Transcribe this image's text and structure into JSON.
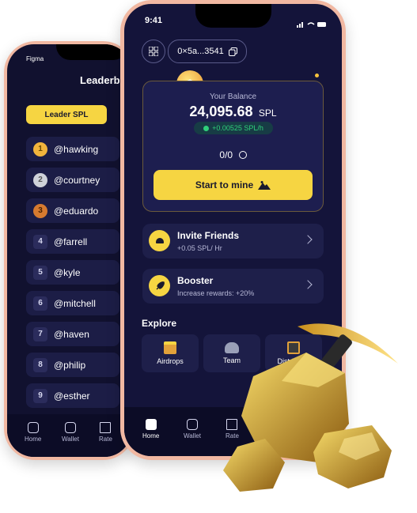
{
  "back_phone": {
    "status_app": "Figma",
    "title": "Leaderboard",
    "tab_button": "Leader SPL",
    "leaders": [
      {
        "rank": "1",
        "name": "@hawking",
        "badge_color": "#f2b43c"
      },
      {
        "rank": "2",
        "name": "@courtney",
        "badge_color": "#cfd2d9"
      },
      {
        "rank": "3",
        "name": "@eduardo",
        "badge_color": "#d67a2f"
      },
      {
        "rank": "4",
        "name": "@farrell"
      },
      {
        "rank": "5",
        "name": "@kyle"
      },
      {
        "rank": "6",
        "name": "@mitchell"
      },
      {
        "rank": "7",
        "name": "@haven"
      },
      {
        "rank": "8",
        "name": "@philip"
      },
      {
        "rank": "9",
        "name": "@esther"
      }
    ],
    "nav": [
      "Home",
      "Wallet",
      "Rate"
    ]
  },
  "front_phone": {
    "time": "9:41",
    "wallet_address": "0×5a...3541",
    "balance": {
      "label": "Your Balance",
      "amount": "24,095.68",
      "unit": "SPL",
      "rate": "+0.00525 SPL/h",
      "referrals": "0/0"
    },
    "mine_button": "Start to mine",
    "cards": [
      {
        "title": "Invite Friends",
        "subtitle": "+0.05 SPL/ Hr"
      },
      {
        "title": "Booster",
        "subtitle": "Increase rewards: +20%"
      }
    ],
    "explore": {
      "title": "Explore",
      "items": [
        "Airdrops",
        "Team",
        "Distributor"
      ]
    },
    "nav": [
      "Home",
      "Wallet",
      "Rate"
    ]
  },
  "colors": {
    "accent": "#f6d542",
    "background": "#11112f",
    "card": "#1e1f4a",
    "frame": "#f1b8a2",
    "rate_green": "#2fcf7a"
  }
}
